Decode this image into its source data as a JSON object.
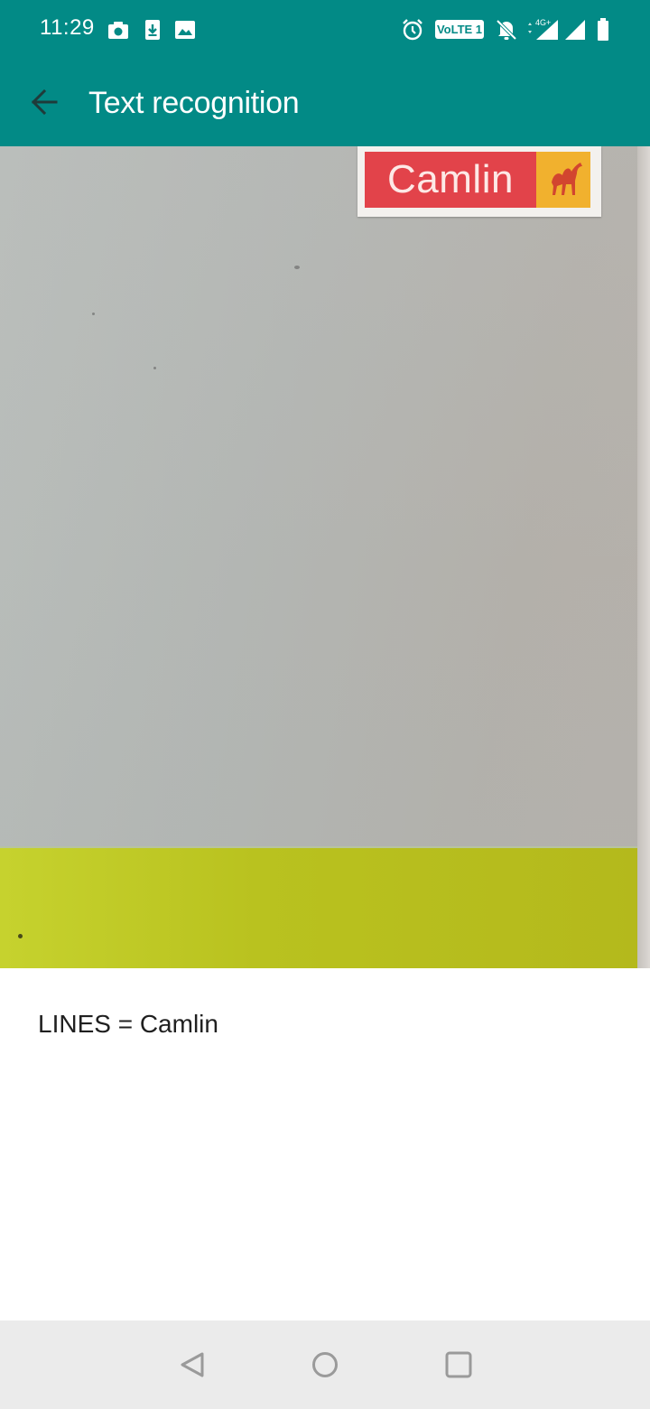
{
  "status_bar": {
    "time": "11:29",
    "volte_label": "VoLTE 1",
    "network_label": "4G+",
    "icons": [
      "camera-icon",
      "download-icon",
      "image-icon",
      "alarm-icon",
      "volte-badge",
      "bell-off-icon",
      "signal-4g-icon",
      "signal-icon",
      "battery-icon"
    ]
  },
  "app_bar": {
    "title": "Text recognition",
    "back_icon": "arrow-back-icon",
    "color": "#028a86"
  },
  "preview": {
    "sign_text": "Camlin",
    "sign_logo_icon": "camel-logo-icon"
  },
  "result": {
    "text": "LINES = Camlin"
  },
  "nav_bar": {
    "buttons": [
      "back-triangle-icon",
      "home-circle-icon",
      "recents-square-icon"
    ]
  }
}
